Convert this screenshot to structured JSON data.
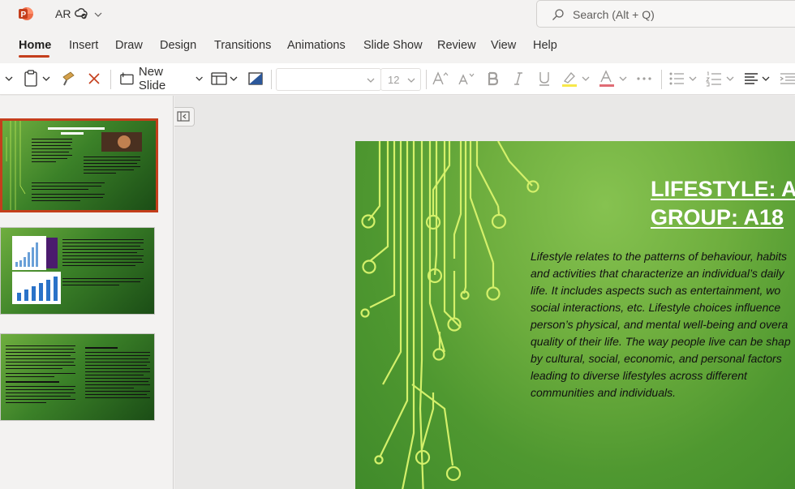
{
  "titlebar": {
    "doc_name": "AR",
    "search_placeholder": "Search (Alt + Q)"
  },
  "tabs": [
    {
      "label": "Home",
      "active": true
    },
    {
      "label": "Insert"
    },
    {
      "label": "Draw"
    },
    {
      "label": "Design"
    },
    {
      "label": "Transitions"
    },
    {
      "label": "Animations"
    },
    {
      "label": "Slide Show"
    },
    {
      "label": "Review"
    },
    {
      "label": "View"
    },
    {
      "label": "Help"
    }
  ],
  "ribbon": {
    "new_slide_label": "New Slide",
    "font_size": "12"
  },
  "slide": {
    "title_line1": "LIFESTYLE: AU",
    "title_line2": "GROUP: A18",
    "body_lines": [
      "Lifestyle relates to the patterns of behaviour, habits",
      "and activities that characterize an individual’s daily",
      "life. It includes aspects such as entertainment, wo",
      "social interactions, etc. Lifestyle choices influence",
      "person’s physical, and mental well-being and overa",
      "quality of their life. The way people live can be shap",
      "by cultural, social, economic, and personal factors",
      "leading to diverse lifestyles across different",
      "communities and individuals."
    ]
  },
  "thumbnails": [
    {
      "index": 1,
      "selected": true
    },
    {
      "index": 2,
      "selected": false
    },
    {
      "index": 3,
      "selected": false
    }
  ],
  "colors": {
    "accent": "#c43e1c",
    "slide_green": "#6eae3e",
    "circuit": "#d4f06a"
  }
}
